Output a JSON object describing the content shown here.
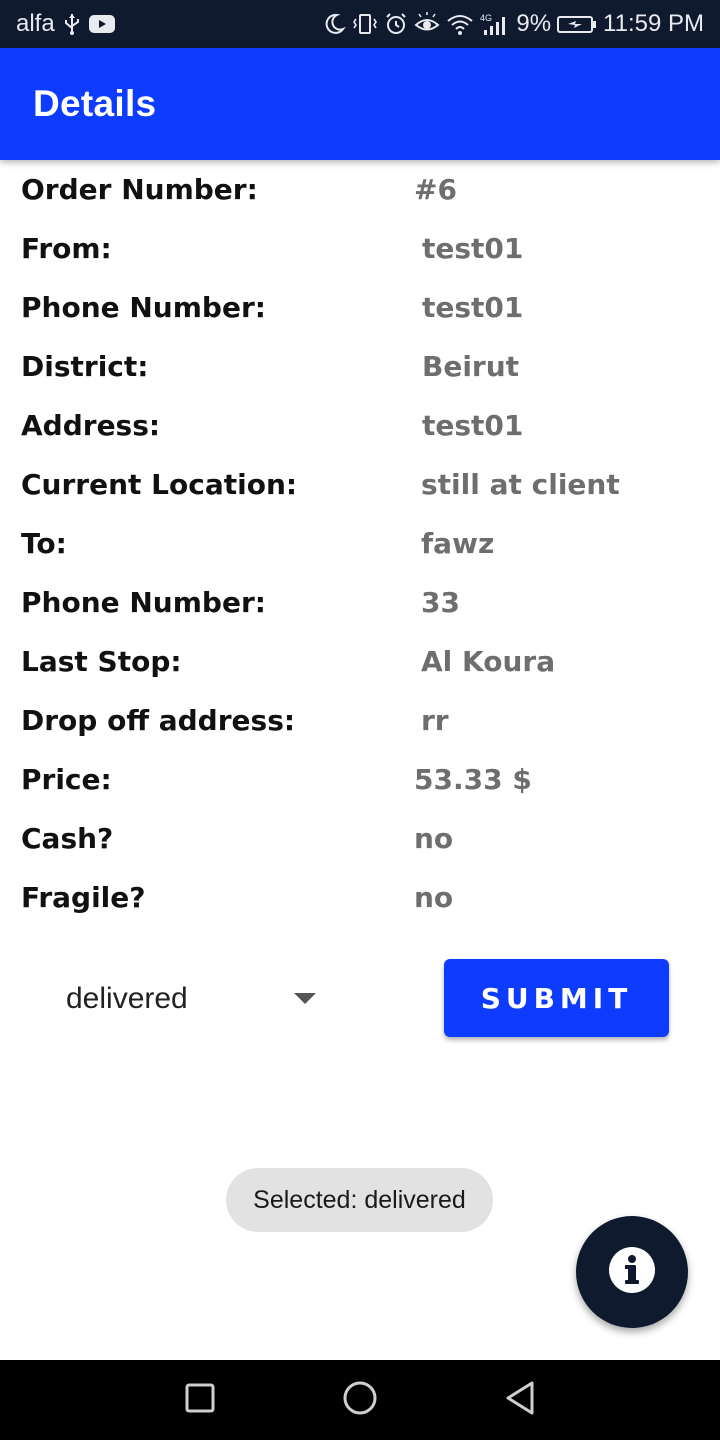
{
  "status_bar": {
    "carrier": "alfa",
    "network_type": "4G",
    "battery": "9%",
    "time": "11:59 PM",
    "icons": [
      "usb-icon",
      "youtube-icon",
      "moon-icon",
      "vibrate-icon",
      "alarm-icon",
      "eye-icon",
      "wifi-icon",
      "signal-icon",
      "battery-icon"
    ]
  },
  "app_bar": {
    "title": "Details",
    "color": "#0d3cff"
  },
  "details": [
    {
      "label": "Order Number:",
      "value": "#6"
    },
    {
      "label": "From:",
      "value": "test01"
    },
    {
      "label": "Phone Number:",
      "value": "test01"
    },
    {
      "label": "District:",
      "value": "Beirut"
    },
    {
      "label": "Address:",
      "value": "test01"
    },
    {
      "label": "Current Location:",
      "value": "still at client"
    },
    {
      "label": "To:",
      "value": "fawz"
    },
    {
      "label": "Phone Number:",
      "value": "33"
    },
    {
      "label": "Last Stop:",
      "value": "Al Koura"
    },
    {
      "label": "Drop off address:",
      "value": "rr"
    },
    {
      "label": "Price:",
      "value": "53.33 $"
    },
    {
      "label": "Cash?",
      "value": "no"
    },
    {
      "label": "Fragile?",
      "value": "no"
    }
  ],
  "status_select": {
    "selected": "delivered",
    "icon": "chevron-down-icon"
  },
  "submit_button": {
    "label": "SUBMIT",
    "color": "#0d3cff"
  },
  "toast": {
    "message": "Selected: delivered"
  },
  "fab": {
    "icon": "info-icon",
    "color": "#0f1a2e"
  },
  "nav_bar": {
    "buttons": [
      "recents-icon",
      "home-icon",
      "back-icon"
    ]
  }
}
